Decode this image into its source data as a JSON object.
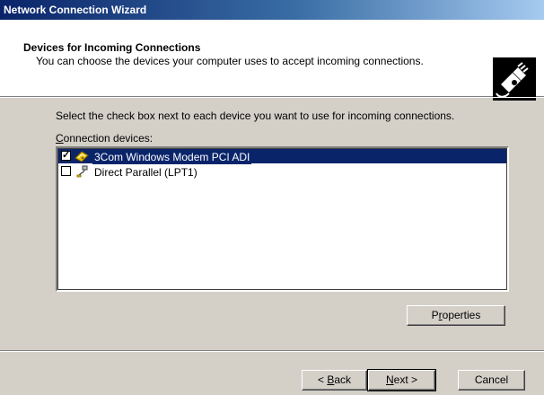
{
  "window": {
    "title": "Network Connection Wizard"
  },
  "header": {
    "title": "Devices for Incoming Connections",
    "subtitle": "You can choose the devices your computer uses to accept incoming connections.",
    "icon": "network-cable-icon"
  },
  "instruction": "Select the check box next to each device you want to use for incoming connections.",
  "devices": {
    "label_prefix": "",
    "label_accel": "C",
    "label_rest": "onnection devices:",
    "items": [
      {
        "label": "3Com Windows Modem PCI ADI",
        "checked": true,
        "selected": true,
        "icon": "modem-icon"
      },
      {
        "label": "Direct Parallel (LPT1)",
        "checked": false,
        "selected": false,
        "icon": "parallel-cable-icon"
      }
    ]
  },
  "buttons": {
    "properties": {
      "pre": "P",
      "accel": "r",
      "post": "operties"
    },
    "back": {
      "pre": "< ",
      "accel": "B",
      "post": "ack"
    },
    "next": {
      "pre": "",
      "accel": "N",
      "post": "ext >"
    },
    "cancel": {
      "label": "Cancel"
    }
  },
  "colors": {
    "title_bar_start": "#0a246a",
    "title_bar_end": "#a6caf0",
    "selection": "#0a246a",
    "dialog_face": "#d4d0c8"
  }
}
